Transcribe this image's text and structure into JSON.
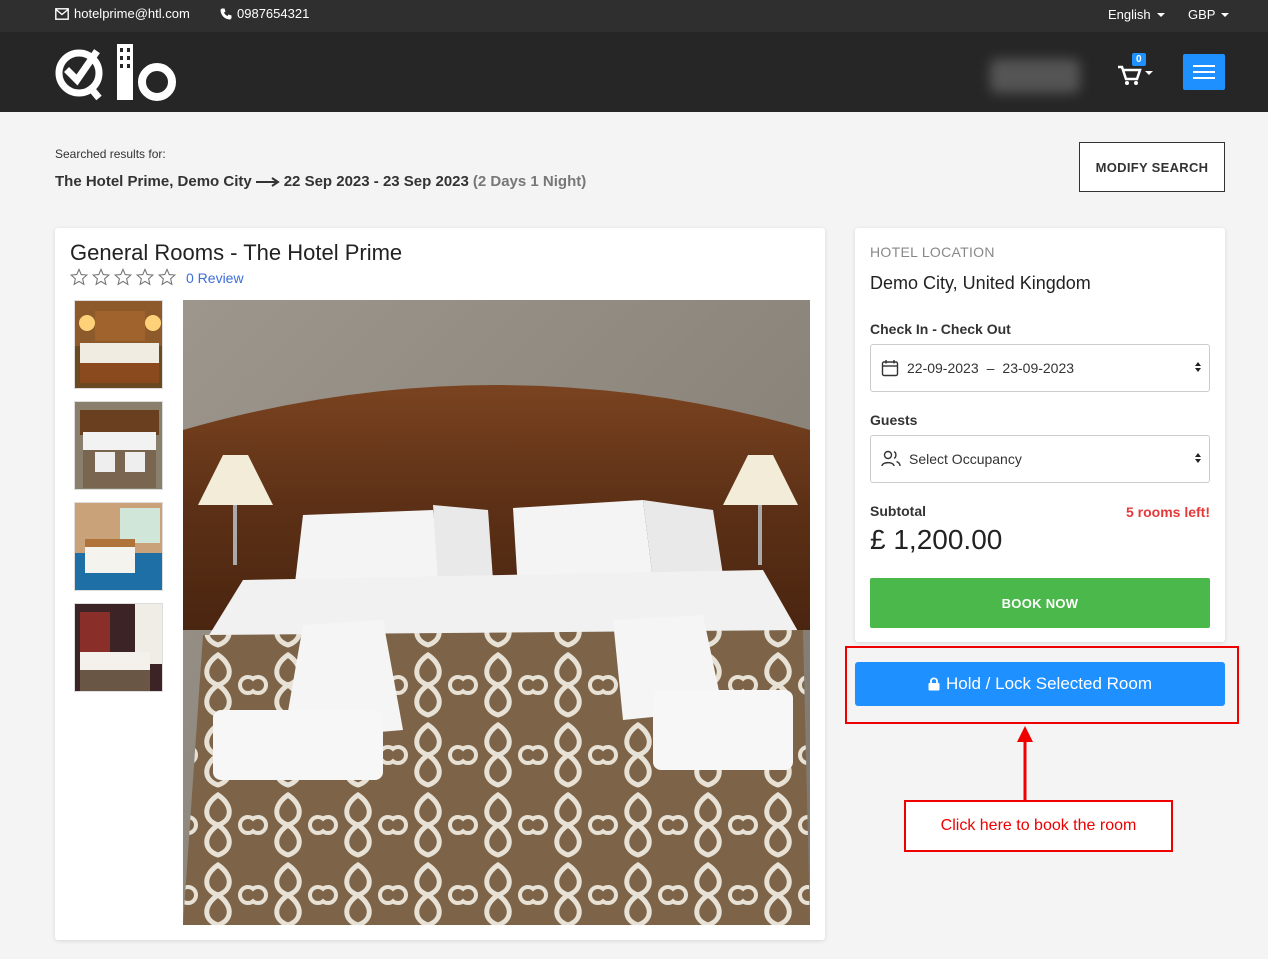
{
  "topbar": {
    "email": "hotelprime@htl.com",
    "phone": "0987654321",
    "language": "English",
    "currency": "GBP"
  },
  "header": {
    "logo_text": "Qlo",
    "cart_count": "0"
  },
  "search": {
    "label": "Searched results for:",
    "location": "The Hotel Prime, Demo City",
    "dates": "22 Sep 2023 - 23 Sep 2023",
    "duration": "(2 Days 1 Night)",
    "modify_label": "MODIFY SEARCH"
  },
  "room": {
    "title": "General Rooms  - The Hotel Prime",
    "rating": 0,
    "reviews": "0 Review"
  },
  "booking": {
    "location_heading": "HOTEL LOCATION",
    "location": "Demo City, United Kingdom",
    "dates_label": "Check In - Check Out",
    "check_in": "22-09-2023",
    "date_separator": "–",
    "check_out": "23-09-2023",
    "guests_label": "Guests",
    "guests_placeholder": "Select Occupancy",
    "subtotal_label": "Subtotal",
    "rooms_left": "5 rooms left!",
    "subtotal": "£ 1,200.00",
    "book_label": "BOOK NOW",
    "hold_label": "Hold / Lock Selected Room"
  },
  "annotation": {
    "note": "Click here to book the room",
    "color": "#e00000"
  },
  "colors": {
    "primary": "#1e90ff",
    "success": "#4ab84a",
    "danger": "#e53939",
    "header_bg": "#262626"
  }
}
